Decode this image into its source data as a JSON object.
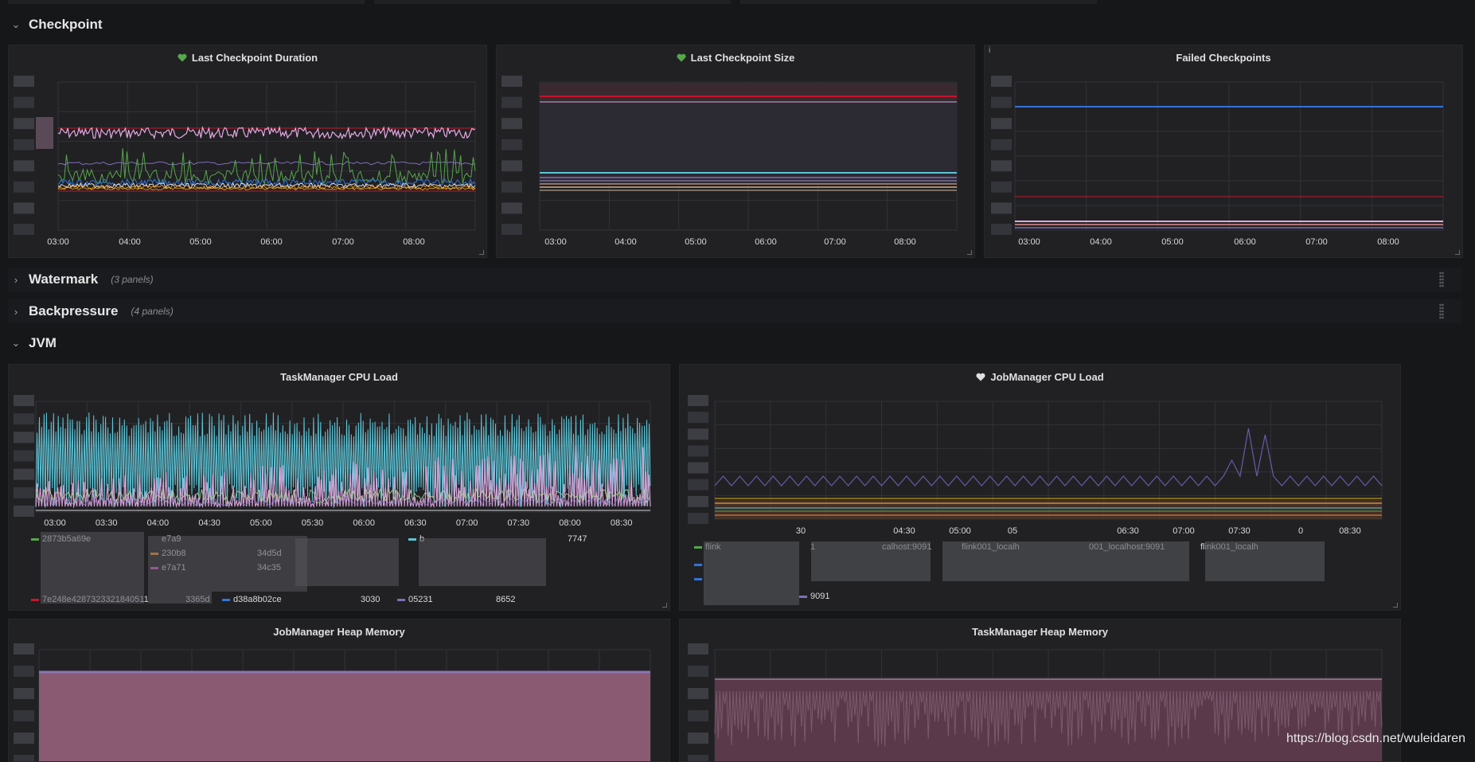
{
  "rows": [
    {
      "title": "Checkpoint",
      "collapsed": false,
      "meta": ""
    },
    {
      "title": "Watermark",
      "collapsed": true,
      "meta": "(3 panels)"
    },
    {
      "title": "Backpressure",
      "collapsed": true,
      "meta": "(4 panels)"
    },
    {
      "title": "JVM",
      "collapsed": false,
      "meta": ""
    }
  ],
  "panels": {
    "last_checkpoint_duration": {
      "title": "Last Checkpoint Duration",
      "health": "ok",
      "x_ticks": [
        "03:00",
        "04:00",
        "05:00",
        "06:00",
        "07:00",
        "08:00"
      ]
    },
    "last_checkpoint_size": {
      "title": "Last Checkpoint Size",
      "health": "ok",
      "x_ticks": [
        "03:00",
        "04:00",
        "05:00",
        "06:00",
        "07:00",
        "08:00"
      ]
    },
    "failed_checkpoints": {
      "title": "Failed Checkpoints",
      "x_ticks": [
        "03:00",
        "04:00",
        "05:00",
        "06:00",
        "07:00",
        "08:00"
      ]
    },
    "taskmanager_cpu_load": {
      "title": "TaskManager CPU Load",
      "x_ticks": [
        "03:00",
        "03:30",
        "04:00",
        "04:30",
        "05:00",
        "05:30",
        "06:00",
        "06:30",
        "07:00",
        "07:30",
        "08:00",
        "08:30"
      ],
      "legend": [
        "2873b5a69e",
        "e7a9",
        "b",
        "7747",
        "230b8",
        "34d5d",
        "e7a71",
        "34c35",
        "7e248e4287323321840511",
        "3365d",
        "d38a8b02ce",
        "3030",
        "05231",
        "8652"
      ]
    },
    "jobmanager_cpu_load": {
      "title": "JobManager CPU Load",
      "health": "ok-white",
      "x_ticks": [
        "30",
        "04:30",
        "05:00",
        "05",
        "06:30",
        "07:00",
        "07:30",
        "0",
        "08:30"
      ],
      "legend": [
        "flink",
        "1",
        "calhost:9091",
        "flink001_localh",
        "001_localhost:9091",
        "flink001_localh",
        "9091"
      ]
    },
    "jobmanager_heap_memory": {
      "title": "JobManager Heap Memory"
    },
    "taskmanager_heap_memory": {
      "title": "TaskManager Heap Memory"
    }
  },
  "colors": {
    "pink": "#e5a8e2",
    "cyan": "#5ec4d6",
    "purple": "#806eb7",
    "red": "#c4162a",
    "green": "#56a64b",
    "blue": "#3274d9",
    "orange": "#ff9830",
    "yellow": "#e0b400",
    "heap": "#8a5a73"
  },
  "watermark": "https://blog.csdn.net/wuleidaren"
}
